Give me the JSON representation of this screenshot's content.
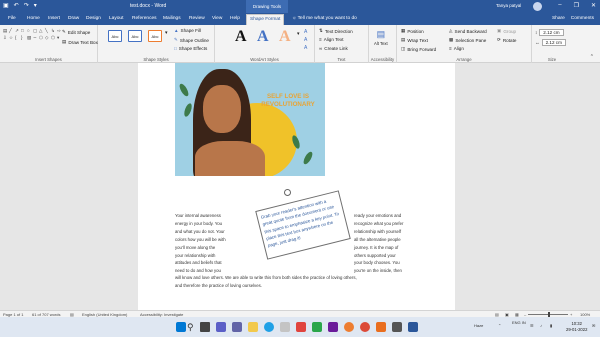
{
  "titlebar": {
    "title": "test.docx  -  Word",
    "drawing_tools": "Drawing Tools",
    "user": "Tanya patyal",
    "undo_icon": "undo-icon",
    "redo_icon": "redo-icon",
    "save_icon": "save-icon"
  },
  "tabs": [
    "File",
    "Home",
    "Insert",
    "Draw",
    "Design",
    "Layout",
    "References",
    "Mailings",
    "Review",
    "View",
    "Help",
    "Shape Format"
  ],
  "tellme": "Tell me what you want to do",
  "tabs_right": {
    "share": "Share",
    "comments": "Comments"
  },
  "ribbon": {
    "insert_shapes": {
      "label": "Insert Shapes",
      "edit_shape": "Edit Shape",
      "draw_text_box": "Draw Text Box"
    },
    "shape_styles": {
      "label": "Shape Styles",
      "box_label": "Abc",
      "fill": "Shape Fill",
      "outline": "Shape Outline",
      "effects": "Shape Effects"
    },
    "wordart": {
      "label": "WordArt Styles",
      "letter": "A"
    },
    "text": {
      "label": "Text",
      "direction": "Text Direction",
      "align": "Align Text",
      "link": "Create Link"
    },
    "accessibility": {
      "label": "Accessibility",
      "alt_text": "Alt Text"
    },
    "arrange": {
      "label": "Arrange",
      "position": "Position",
      "wrap": "Wrap Text",
      "forward": "Bring Forward",
      "backward": "Send Backward",
      "pane": "Selection Pane",
      "align": "Align",
      "group": "Group",
      "rotate": "Rotate"
    },
    "size": {
      "label": "Size",
      "height": "2.12 cm",
      "width": "2.12 cm"
    }
  },
  "art": {
    "text": "SELF LOVE IS REVOLUTIONARY"
  },
  "doc": {
    "left_col": [
      "Your internal awareness",
      "energy in your body. You",
      "and what you do not. Your",
      "colors how you will be with",
      "you'll move along the",
      "your relationship with",
      "attitudes and beliefs that",
      "need to do and how you"
    ],
    "right_col": [
      "ready your emotions and",
      "recognize what you prefer",
      "relationship with yourself",
      "all the alternative people",
      "journey. It is the map of",
      "others supported your",
      "your body chooses. You",
      "you're on the inside, then"
    ],
    "full_lines": [
      "will know and love others. We are able to write this from both sides the practice of loving others,",
      "and therefore the practice of loving ourselves."
    ],
    "textbox": "Grab your reader's attention with a great quote from the document or use this space to emphasize a key point. To place this text box anywhere on the page, just drag it!"
  },
  "status": {
    "page": "Page 1 of 1",
    "words": "61 of 707 words",
    "language": "English (United Kingdom)",
    "accessibility": "Accessibility: Investigate",
    "zoom": "100%"
  },
  "taskbar": {
    "weather": "Haze",
    "lang": "ENG IN",
    "time": "10:32",
    "date": "29-01-2022"
  }
}
